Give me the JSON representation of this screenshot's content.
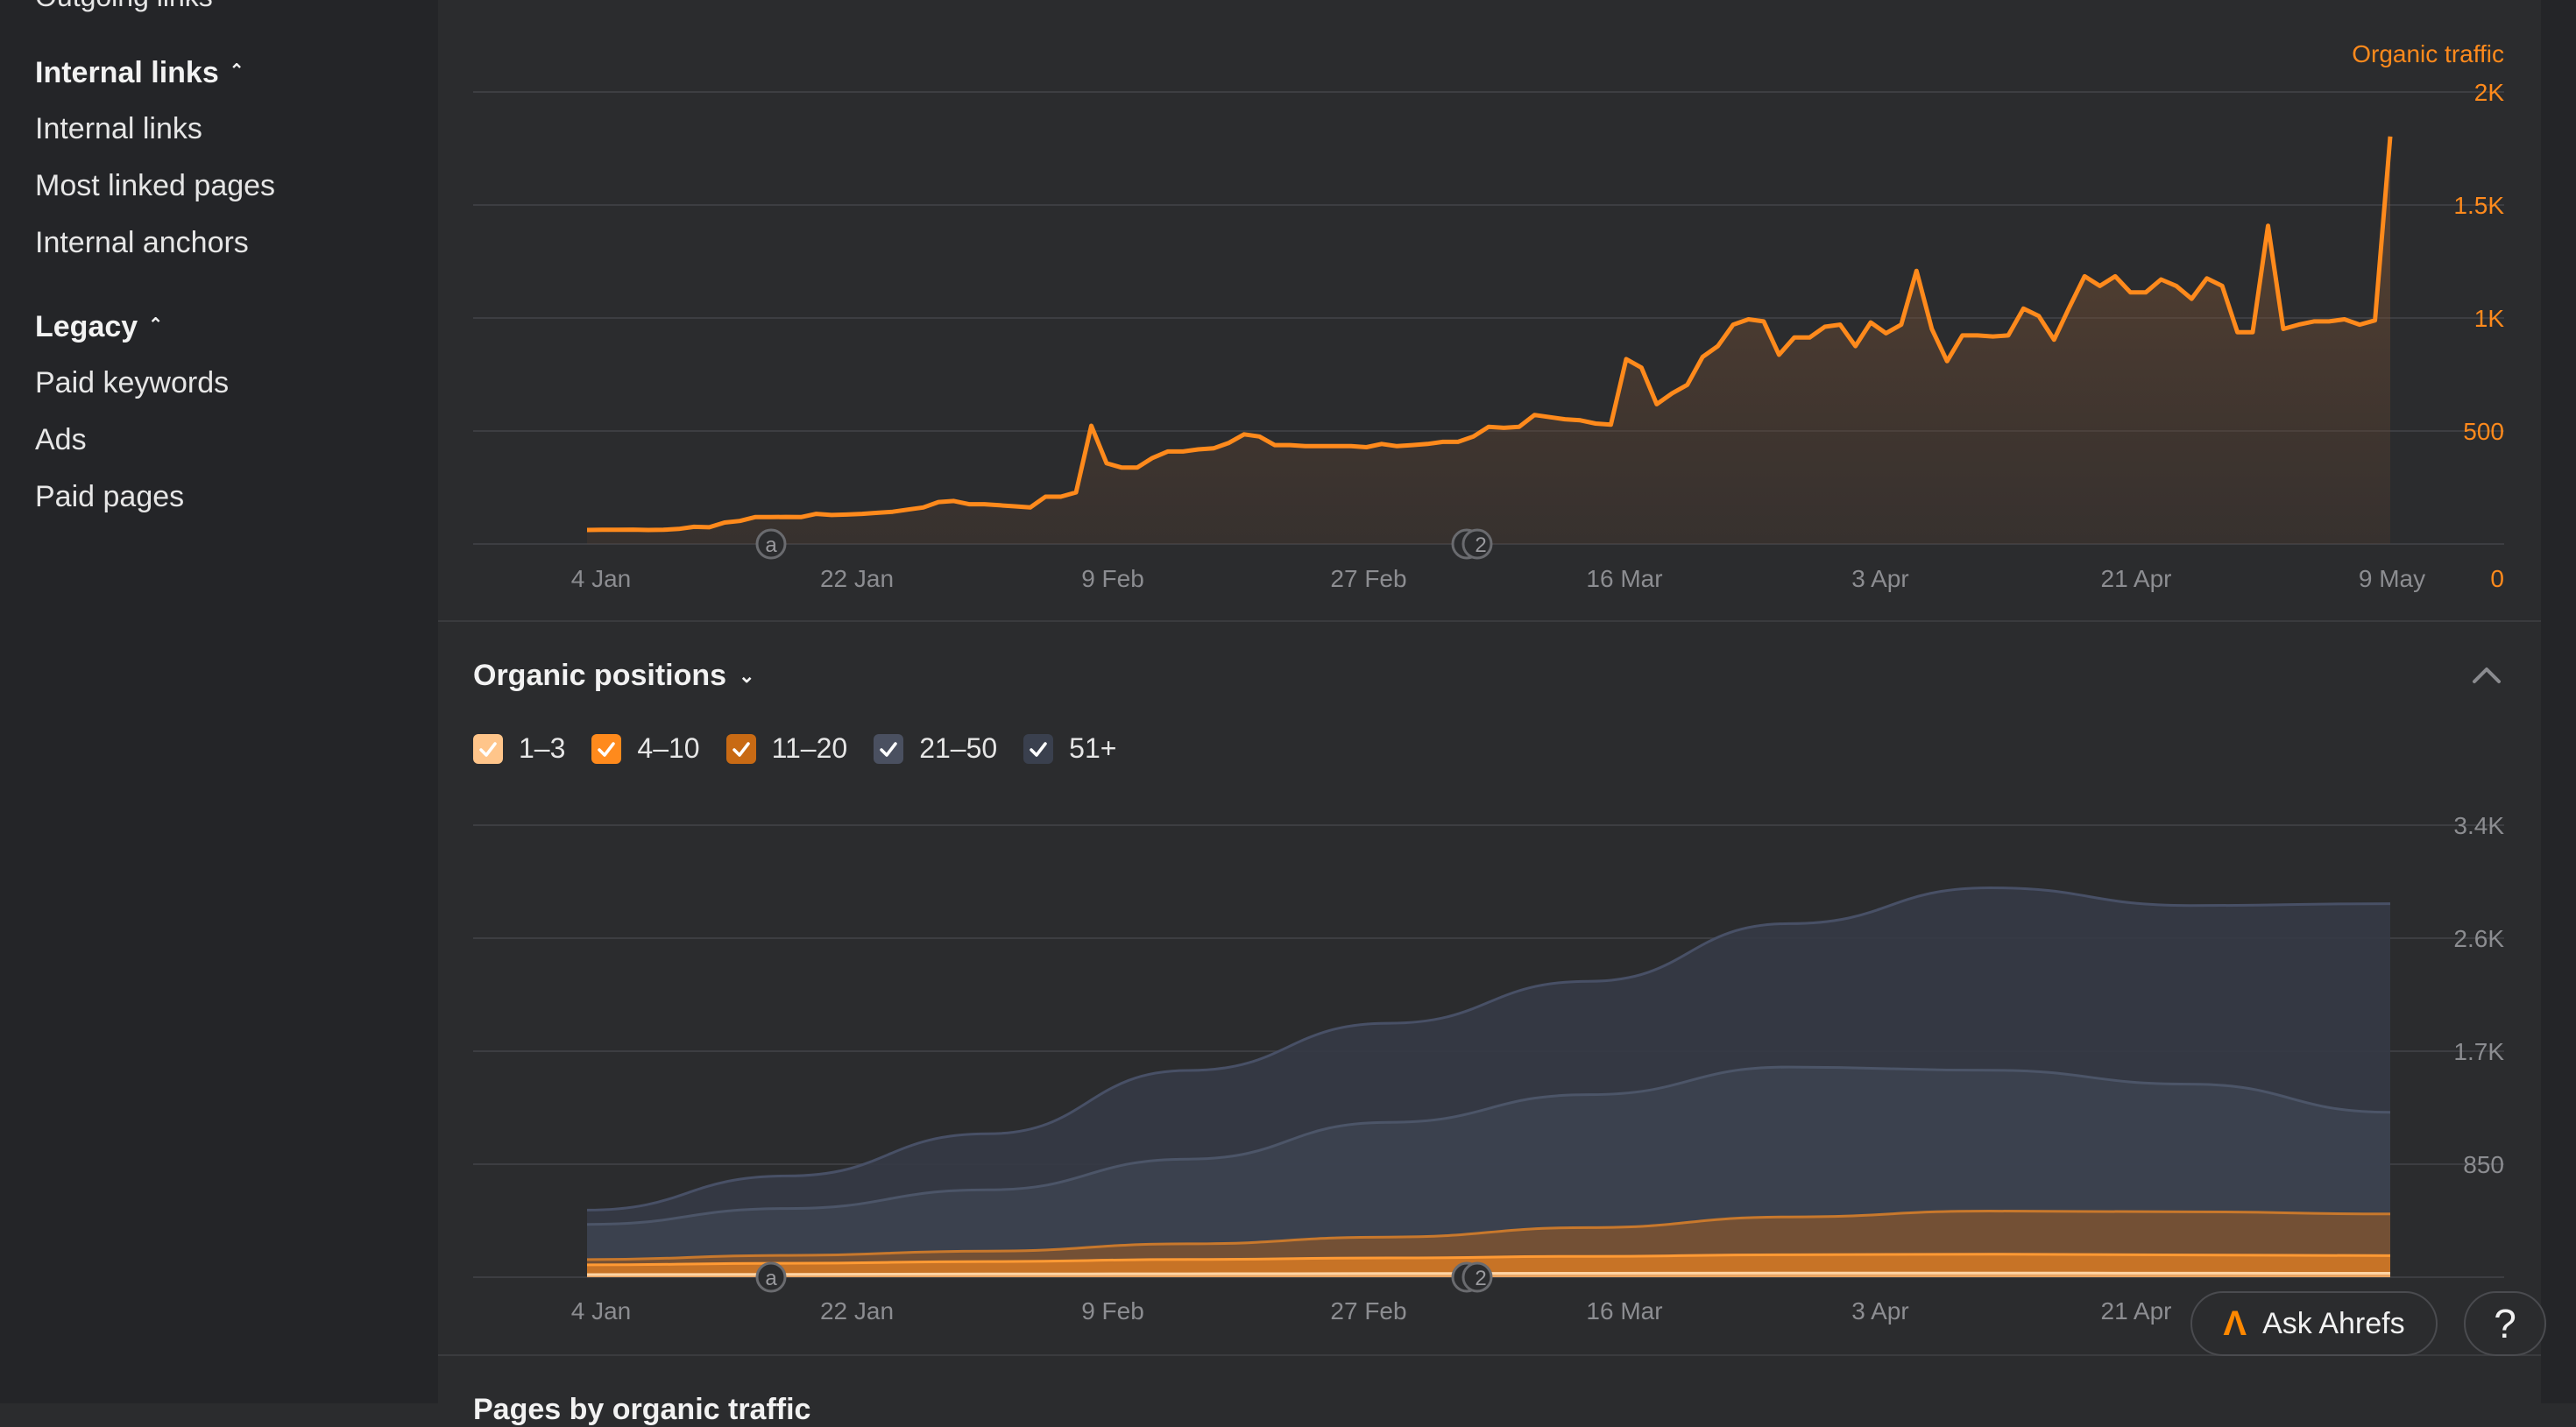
{
  "sidebar": {
    "cut_item": "Outgoing links",
    "sections": [
      {
        "title": "Internal links",
        "items": [
          "Internal links",
          "Most linked pages",
          "Internal anchors"
        ]
      },
      {
        "title": "Legacy",
        "items": [
          "Paid keywords",
          "Ads",
          "Paid pages"
        ]
      }
    ]
  },
  "traffic_chart": {
    "series_label": "Organic traffic",
    "x_ticks": [
      "4 Jan",
      "22 Jan",
      "9 Feb",
      "27 Feb",
      "16 Mar",
      "3 Apr",
      "21 Apr",
      "9 May"
    ],
    "y_ticks": [
      "0",
      "500",
      "1K",
      "1.5K",
      "2K"
    ],
    "annotations": [
      "a",
      "2"
    ]
  },
  "positions_chart": {
    "title": "Organic positions",
    "x_ticks": [
      "4 Jan",
      "22 Jan",
      "9 Feb",
      "27 Feb",
      "16 Mar",
      "3 Apr",
      "21 Apr"
    ],
    "y_ticks": [
      "850",
      "1.7K",
      "2.6K",
      "3.4K"
    ],
    "annotations": [
      "a",
      "2"
    ],
    "legend": [
      {
        "label": "1–3",
        "color": "#ffc58a",
        "checked": true
      },
      {
        "label": "4–10",
        "color": "#ff8a1c",
        "checked": true
      },
      {
        "label": "11–20",
        "color": "#c86a14",
        "checked": true
      },
      {
        "label": "21–50",
        "color": "#4a5060",
        "checked": true
      },
      {
        "label": "51+",
        "color": "#3a404e",
        "checked": true
      }
    ]
  },
  "next_section_title": "Pages by organic traffic",
  "ask_button": "Ask Ahrefs",
  "help_button": "?",
  "chart_data": [
    {
      "type": "line",
      "title": "",
      "series": [
        {
          "name": "Organic traffic",
          "x_ticks_shown": [
            "4 Jan",
            "22 Jan",
            "9 Feb",
            "27 Feb",
            "16 Mar",
            "3 Apr",
            "21 Apr",
            "9 May"
          ],
          "values": [
            65,
            66,
            66,
            67,
            65,
            66,
            70,
            80,
            78,
            100,
            107,
            125,
            125,
            126,
            125,
            140,
            135,
            137,
            140,
            145,
            150,
            160,
            170,
            195,
            200,
            185,
            185,
            180,
            175,
            170,
            220,
            220,
            240,
            550,
            375,
            355,
            355,
            400,
            430,
            430,
            440,
            445,
            470,
            510,
            500,
            460,
            460,
            455,
            455,
            455,
            455,
            450,
            465,
            455,
            460,
            465,
            475,
            475,
            500,
            545,
            540,
            545,
            600,
            590,
            580,
            575,
            560,
            555,
            860,
            820,
            650,
            700,
            740,
            870,
            920,
            1020,
            1045,
            1035,
            880,
            960,
            960,
            1010,
            1020,
            920,
            1030,
            980,
            1020,
            1270,
            1000,
            850,
            970,
            970,
            965,
            970,
            1095,
            1060,
            950,
            1100,
            1245,
            1200,
            1245,
            1170,
            1170,
            1230,
            1200,
            1140,
            1235,
            1200,
            985,
            985,
            1480,
            1000,
            1020,
            1035,
            1035,
            1045,
            1020,
            1040,
            1895
          ]
        }
      ],
      "xlabel": "",
      "ylabel": "",
      "ylim": [
        0,
        2000
      ]
    },
    {
      "type": "area",
      "title": "Organic positions",
      "categories_shown": [
        "4 Jan",
        "22 Jan",
        "9 Feb",
        "27 Feb",
        "16 Mar",
        "3 Apr",
        "21 Apr"
      ],
      "series": [
        {
          "name": "1–3",
          "values": [
            20,
            22,
            25,
            26,
            28,
            30,
            32,
            32,
            31,
            30
          ]
        },
        {
          "name": "4–10",
          "values": [
            75,
            85,
            95,
            110,
            120,
            130,
            140,
            145,
            140,
            135
          ]
        },
        {
          "name": "11–20",
          "values": [
            40,
            60,
            80,
            120,
            160,
            220,
            290,
            330,
            330,
            320
          ]
        },
        {
          "name": "21–50",
          "values": [
            270,
            360,
            470,
            650,
            880,
            1020,
            1150,
            1080,
            980,
            780
          ]
        },
        {
          "name": "51+",
          "values": [
            110,
            250,
            430,
            680,
            760,
            870,
            1100,
            1400,
            1370,
            1600
          ]
        }
      ],
      "ylim": [
        0,
        3400
      ]
    }
  ]
}
